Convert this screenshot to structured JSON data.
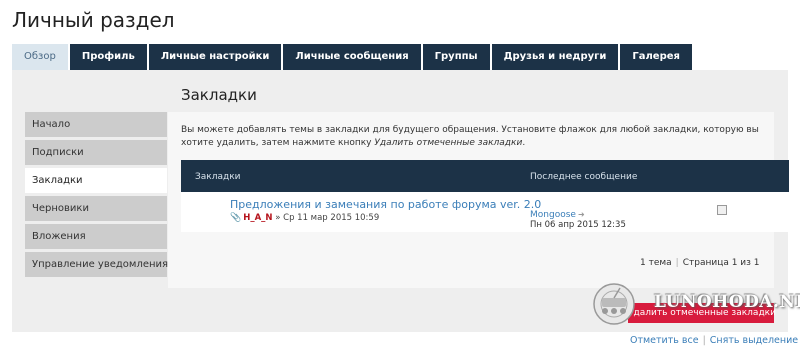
{
  "page_title": "Личный раздел",
  "tabs": [
    {
      "label": "Обзор"
    },
    {
      "label": "Профиль"
    },
    {
      "label": "Личные настройки"
    },
    {
      "label": "Личные сообщения"
    },
    {
      "label": "Группы"
    },
    {
      "label": "Друзья и недруги"
    },
    {
      "label": "Галерея"
    }
  ],
  "sidebar": {
    "items": [
      {
        "label": "Начало"
      },
      {
        "label": "Подписки"
      },
      {
        "label": "Закладки"
      },
      {
        "label": "Черновики"
      },
      {
        "label": "Вложения"
      },
      {
        "label": "Управление уведомлениями"
      }
    ]
  },
  "main": {
    "title": "Закладки",
    "description_part1": "Вы можете добавлять темы в закладки для будущего обращения. Установите флажок для любой закладки, которую вы хотите удалить, затем нажмите кнопку ",
    "description_em": "Удалить отмеченные закладки",
    "description_end": "."
  },
  "table": {
    "col_topics": "Закладки",
    "col_last": "Последнее сообщение",
    "rows": [
      {
        "title": "Предложения и замечания по работе форума ver. 2.0",
        "author": "H_A_N",
        "posted": "» Ср 11 мар 2015 10:59",
        "last_user": "Mongoose",
        "last_date": "Пн 06 апр 2015 12:35"
      }
    ]
  },
  "pagination": {
    "count": "1 тема",
    "page": "Страница 1 из 1"
  },
  "delete_button": "Удалить отмеченные закладки",
  "watermark_text": "LUNOHODA.NET",
  "bottom_links": {
    "mark_all": "Отметить все",
    "unmark": "Снять выделение"
  },
  "icons": {
    "attachment": "paperclip-icon",
    "goto_last": "arrow-right-icon",
    "watermark": "lunokhod-logo"
  },
  "colors": {
    "nav_bg": "#1c3247",
    "active_tab_bg": "#dbe6ee",
    "link": "#3a7eb8",
    "author": "#b5121b",
    "delete_button": "#d81b3d"
  }
}
